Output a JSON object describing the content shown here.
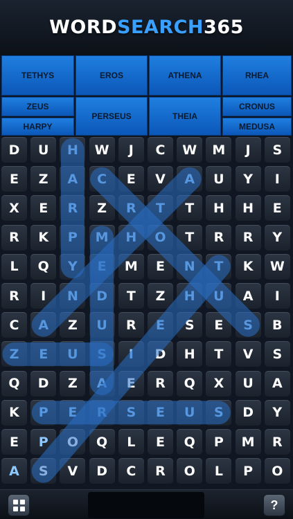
{
  "app": {
    "title_part1": "WORD",
    "title_part2": "SEARCH",
    "title_part3": "365"
  },
  "words": [
    {
      "label": "TETHYS"
    },
    {
      "label": "EROS"
    },
    {
      "label": "ATHENA"
    },
    {
      "label": "RHEA"
    },
    {
      "label": "ZEUS"
    },
    {
      "label": "PERSEUS"
    },
    {
      "label": "THEIA"
    },
    {
      "label": "CRONUS"
    },
    {
      "label": "HARPY"
    },
    {
      "label": "MEDUSA"
    }
  ],
  "grid": [
    [
      "D",
      "U",
      "H",
      "W",
      "J",
      "C",
      "W",
      "M",
      "J",
      "S"
    ],
    [
      "E",
      "Z",
      "A",
      "C",
      "E",
      "V",
      "A",
      "U",
      "Y",
      "I"
    ],
    [
      "X",
      "E",
      "R",
      "Z",
      "R",
      "T",
      "T",
      "H",
      "H",
      "E"
    ],
    [
      "R",
      "K",
      "P",
      "M",
      "H",
      "O",
      "T",
      "R",
      "R",
      "Y"
    ],
    [
      "L",
      "Q",
      "Y",
      "E",
      "M",
      "E",
      "N",
      "T",
      "K",
      "W"
    ],
    [
      "R",
      "I",
      "N",
      "D",
      "T",
      "Z",
      "H",
      "U",
      "A",
      "I"
    ],
    [
      "C",
      "A",
      "Z",
      "U",
      "R",
      "E",
      "S",
      "E",
      "S",
      "B"
    ],
    [
      "Z",
      "E",
      "U",
      "S",
      "I",
      "D",
      "H",
      "T",
      "V",
      "S"
    ],
    [
      "Q",
      "D",
      "Z",
      "A",
      "E",
      "R",
      "Q",
      "X",
      "U",
      "A"
    ],
    [
      "K",
      "P",
      "E",
      "R",
      "S",
      "E",
      "U",
      "S",
      "D",
      "Y"
    ],
    [
      "E",
      "P",
      "O",
      "Q",
      "L",
      "E",
      "Q",
      "P",
      "M",
      "R"
    ],
    [
      "A",
      "S",
      "V",
      "D",
      "C",
      "R",
      "O",
      "L",
      "P",
      "O"
    ]
  ],
  "found_highlights": [
    {
      "word": "HARPY",
      "from": [
        0,
        2
      ],
      "to": [
        4,
        2
      ]
    },
    {
      "word": "ZEUS",
      "from": [
        7,
        0
      ],
      "to": [
        7,
        3
      ]
    },
    {
      "word": "PERSEUS",
      "from": [
        9,
        1
      ],
      "to": [
        9,
        7
      ]
    },
    {
      "word": "ATHENA",
      "from": [
        1,
        6
      ],
      "to": [
        6,
        1
      ]
    },
    {
      "word": "MEDUSA",
      "from": [
        3,
        3
      ],
      "to": [
        8,
        3
      ]
    },
    {
      "word": "CRONUS",
      "from": [
        1,
        3
      ],
      "to": [
        6,
        8
      ]
    },
    {
      "word": "TETHYS",
      "from": [
        4,
        7
      ],
      "to": [
        11,
        1
      ]
    }
  ],
  "colors": {
    "accent": "#3aa0ff",
    "word_button": "#1f7fe0",
    "highlight": "#2a6fc4"
  },
  "icons": {
    "menu": "grid-icon",
    "help": "question-icon"
  },
  "bottom": {
    "help_label": "?"
  }
}
